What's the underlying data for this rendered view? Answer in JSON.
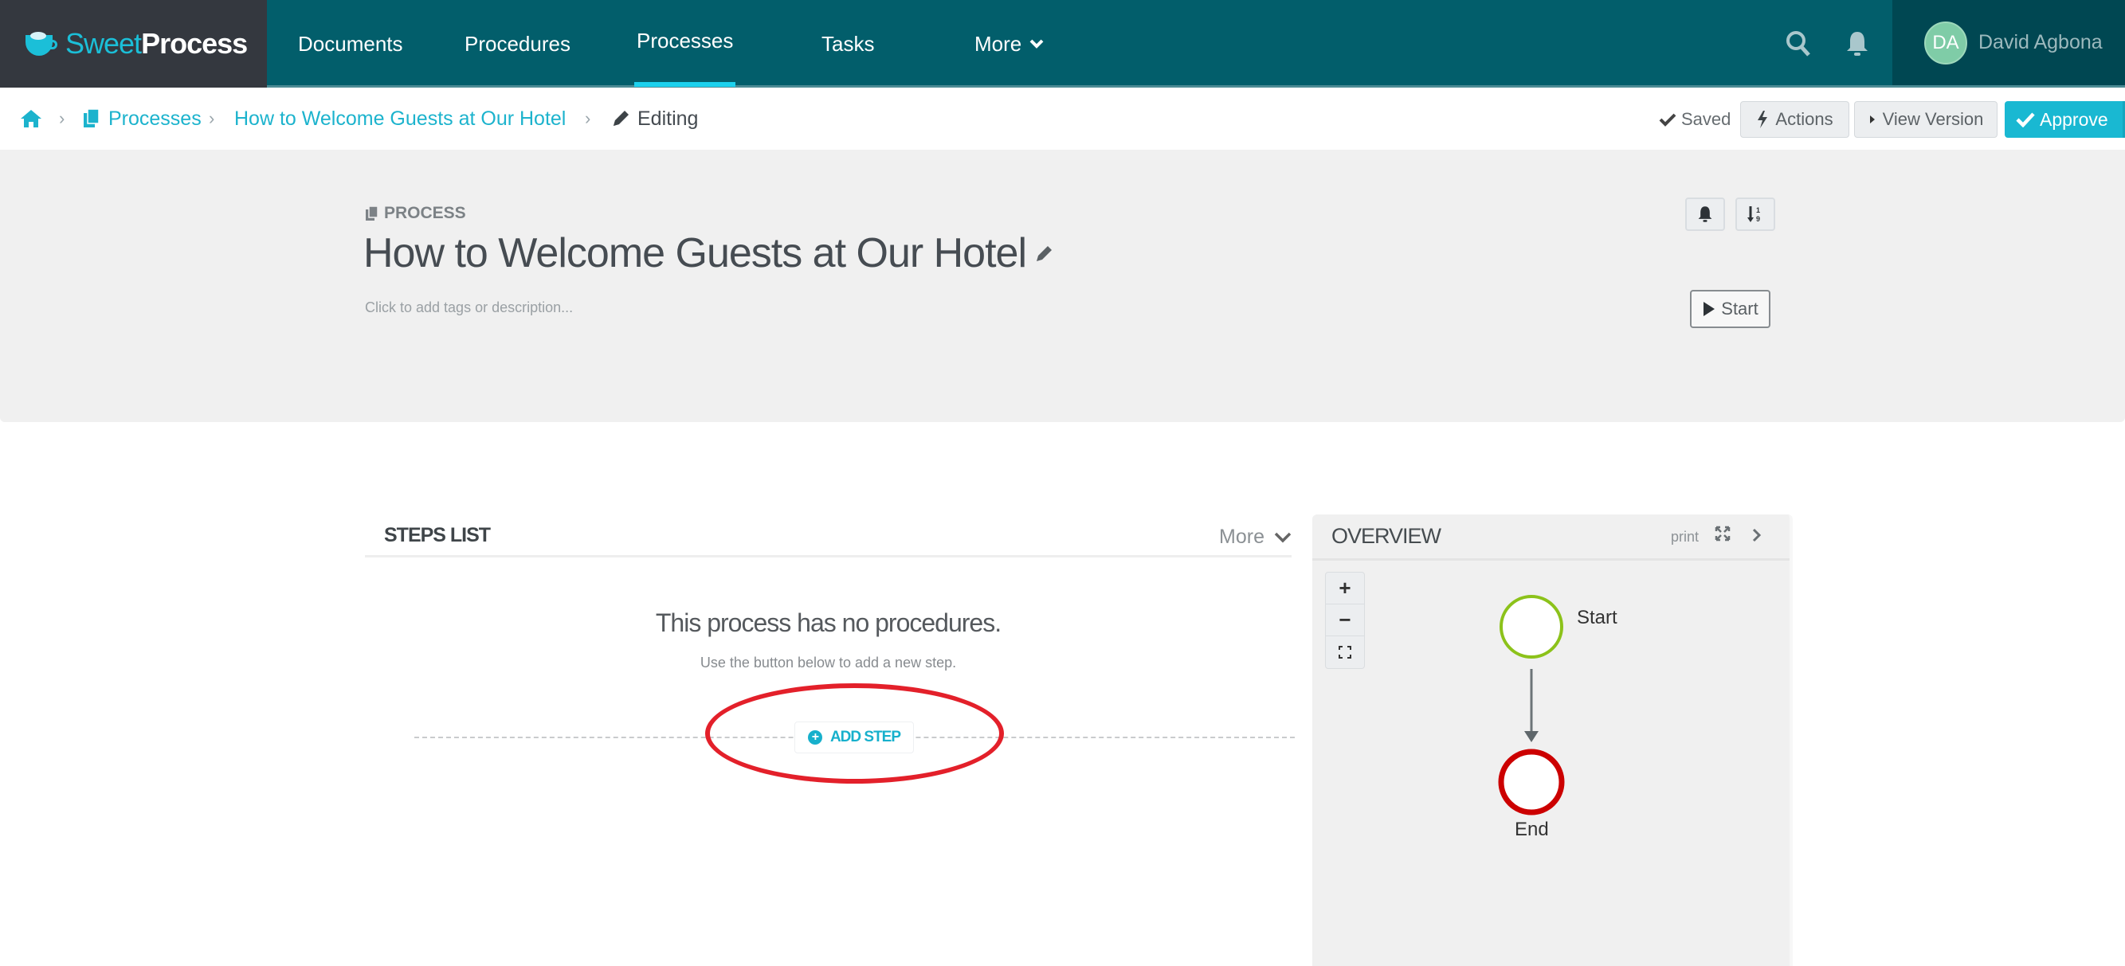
{
  "app": {
    "brand_part1": "Sweet",
    "brand_part2": "Process"
  },
  "nav": {
    "items": [
      {
        "label": "Documents",
        "active": false
      },
      {
        "label": "Procedures",
        "active": false
      },
      {
        "label": "Processes",
        "active": true
      },
      {
        "label": "Tasks",
        "active": false
      },
      {
        "label": "More",
        "active": false
      }
    ],
    "icons": {
      "search": "search-icon",
      "bell": "bell-icon",
      "chevron": "chevron-down-icon"
    },
    "user": {
      "initials": "DA",
      "name": "David Agbona"
    },
    "colors": {
      "bar": "#025e6b",
      "logo_bg": "#34383f",
      "user_bg": "#004752",
      "active_underline": "#1bd1ee"
    }
  },
  "breadcrumb": {
    "home_icon": "home-icon",
    "separator": "›",
    "items": [
      {
        "label": "Processes",
        "icon": "copy-icon"
      },
      {
        "label": "How to Welcome Guests at Our Hotel"
      }
    ],
    "current": {
      "label": "Editing",
      "icon": "pencil-icon"
    }
  },
  "toolbar": {
    "saved_label": "Saved",
    "actions_label": "Actions",
    "view_version_label": "View Version",
    "approve_label": "Approve",
    "approve_color": "#19b8d2"
  },
  "process": {
    "type_label": "PROCESS",
    "title": "How to Welcome Guests at Our Hotel",
    "description_placeholder": "Click to add tags or description...",
    "start_label": "Start"
  },
  "steps": {
    "title": "STEPS LIST",
    "more_label": "More",
    "empty_title": "This process has no procedures.",
    "empty_subtitle": "Use the button below to add a new step.",
    "add_step_label": "ADD STEP",
    "annotation_color": "#e3202a"
  },
  "overview": {
    "title": "OVERVIEW",
    "print_label": "print",
    "zoom_in": "+",
    "zoom_out": "−",
    "fit": "⛶",
    "nodes": [
      {
        "label": "Start",
        "type": "start",
        "color": "#8cc21a"
      },
      {
        "label": "End",
        "type": "end",
        "color": "#cc0000"
      }
    ]
  }
}
